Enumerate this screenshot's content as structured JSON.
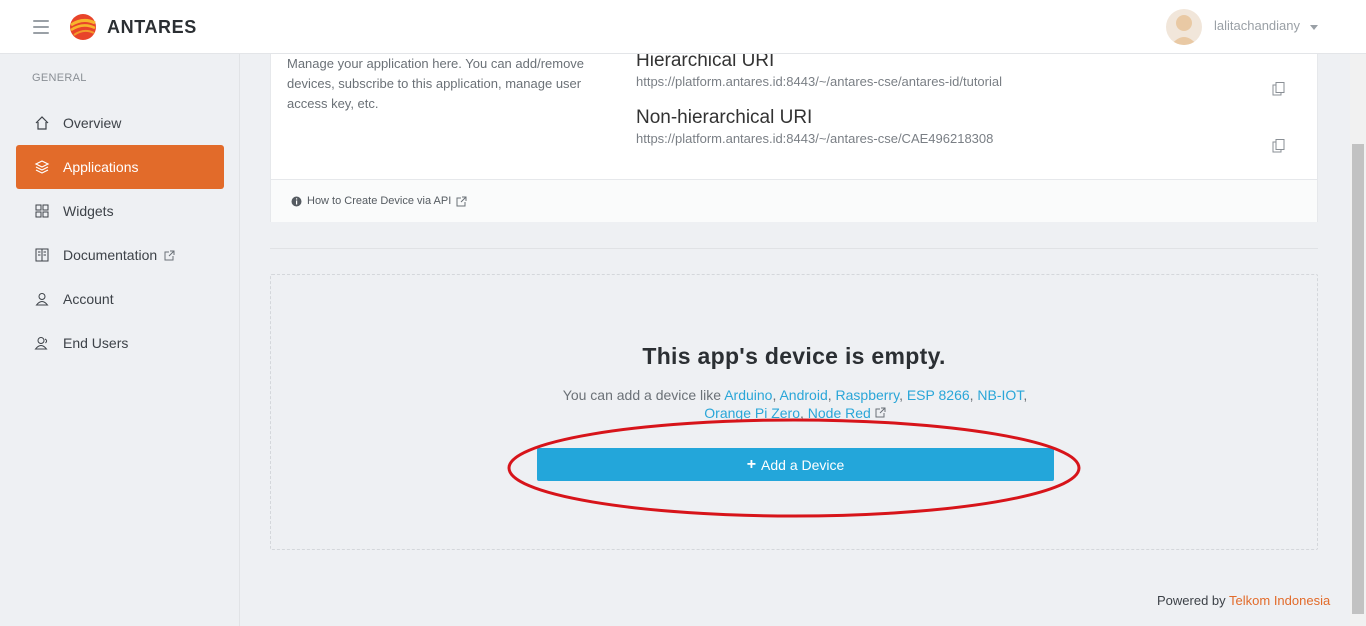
{
  "brand": {
    "name": "ANTARES"
  },
  "user": {
    "name": "lalitachandiany"
  },
  "sidebar": {
    "heading": "GENERAL",
    "items": [
      {
        "label": "Overview",
        "icon": "home-icon",
        "active": false
      },
      {
        "label": "Applications",
        "icon": "layers-icon",
        "active": true
      },
      {
        "label": "Widgets",
        "icon": "grid-icon",
        "active": false
      },
      {
        "label": "Documentation",
        "icon": "book-icon",
        "active": false,
        "external": true
      },
      {
        "label": "Account",
        "icon": "user-icon",
        "active": false
      },
      {
        "label": "End Users",
        "icon": "users-icon",
        "active": false
      }
    ]
  },
  "app_card": {
    "description": "Manage your application here. You can add/remove devices, subscribe to this application, manage user access key, etc.",
    "hierarchical_title": "Hierarchical URI",
    "hierarchical_value": "https://platform.antares.id:8443/~/antares-cse/antares-id/tutorial",
    "nonhierarchical_title": "Non-hierarchical URI",
    "nonhierarchical_value": "https://platform.antares.id:8443/~/antares-cse/CAE496218308",
    "howto_link": "How to Create Device via API"
  },
  "empty_state": {
    "title": "This app's device is empty.",
    "prefix": "You can add a device like ",
    "links": [
      "Arduino",
      "Android",
      "Raspberry",
      "ESP 8266",
      "NB-IOT",
      "Orange Pi Zero",
      "Node Red"
    ],
    "button_label": "Add a Device"
  },
  "footer": {
    "prefix": "Powered by ",
    "link": "Telkom Indonesia"
  },
  "colors": {
    "accent": "#e26b2a",
    "primary_button": "#23a6da",
    "link": "#2aa6d8",
    "annotation": "#d7141a"
  }
}
